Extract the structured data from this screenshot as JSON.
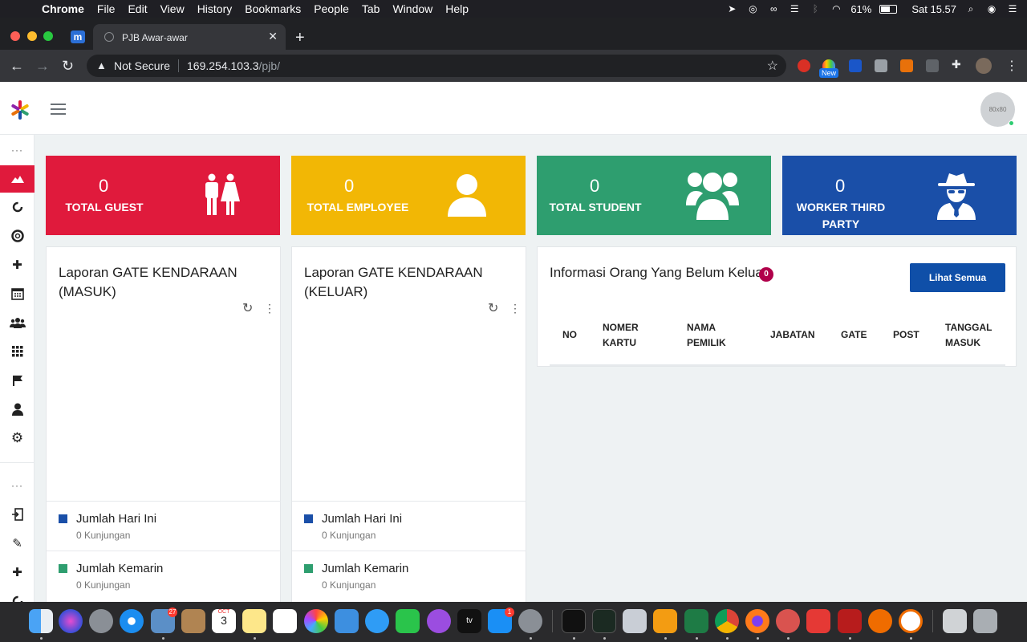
{
  "menubar": {
    "items": [
      "Chrome",
      "File",
      "Edit",
      "View",
      "History",
      "Bookmarks",
      "People",
      "Tab",
      "Window",
      "Help"
    ],
    "battery": "61%",
    "clock": "Sat 15.57"
  },
  "browser": {
    "tab_title": "PJB Awar-awar",
    "security_label": "Not Secure",
    "url_host": "169.254.103.3",
    "url_path": "/pjb/",
    "ext_new_badge": "New"
  },
  "header": {
    "avatar_text": "80x80"
  },
  "stats": [
    {
      "value": "0",
      "label": "TOTAL GUEST",
      "color": "#e01a3c",
      "icon": "guests-icon"
    },
    {
      "value": "0",
      "label": "TOTAL EMPLOYEE",
      "color": "#f2b705",
      "icon": "user-icon"
    },
    {
      "value": "0",
      "label": "TOTAL STUDENT",
      "color": "#2e9e6f",
      "icon": "users-icon"
    },
    {
      "value": "0",
      "label": "WORKER THIRD PARTY",
      "color": "#1a4fa8",
      "icon": "spy-icon"
    }
  ],
  "panels": [
    {
      "title": "Laporan GATE KENDARAAN (MASUK)",
      "legend": [
        {
          "label": "Jumlah Hari Ini",
          "sub": "0 Kunjungan",
          "color": "#1a4fa8"
        },
        {
          "label": "Jumlah Kemarin",
          "sub": "0 Kunjungan",
          "color": "#2e9e6f"
        }
      ]
    },
    {
      "title": "Laporan GATE KENDARAAN (KELUAR)",
      "legend": [
        {
          "label": "Jumlah Hari Ini",
          "sub": "0 Kunjungan",
          "color": "#1a4fa8"
        },
        {
          "label": "Jumlah Kemarin",
          "sub": "0 Kunjungan",
          "color": "#2e9e6f"
        }
      ]
    }
  ],
  "info": {
    "title": "Informasi Orang Yang Belum Keluar",
    "badge": "0",
    "button": "Lihat Semua",
    "columns": [
      "NO",
      "NOMER KARTU",
      "NAMA PEMILIK",
      "JABATAN",
      "GATE",
      "POST",
      "TANGGAL MASUK"
    ]
  },
  "dock": {
    "badges": {
      "mail": "27",
      "calendar_day": "3",
      "calendar_month": "OCT",
      "appstore": "1"
    }
  }
}
